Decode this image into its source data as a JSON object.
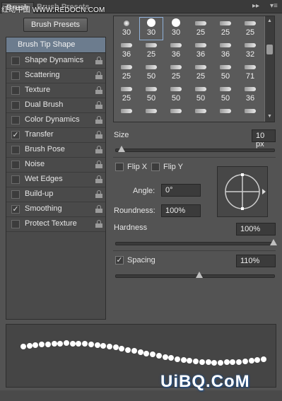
{
  "tabs": {
    "brush": "Brush",
    "brush_presets": "Brush Presets"
  },
  "watermark": "红动中国 WWW.REDOCN.COM",
  "presets_button": "Brush Presets",
  "tip_shape": "Brush Tip Shape",
  "options": [
    {
      "label": "Shape Dynamics",
      "checked": false
    },
    {
      "label": "Scattering",
      "checked": false
    },
    {
      "label": "Texture",
      "checked": false
    },
    {
      "label": "Dual Brush",
      "checked": false
    },
    {
      "label": "Color Dynamics",
      "checked": false
    },
    {
      "label": "Transfer",
      "checked": true
    },
    {
      "label": "Brush Pose",
      "checked": false
    },
    {
      "label": "Noise",
      "checked": false
    },
    {
      "label": "Wet Edges",
      "checked": false
    },
    {
      "label": "Build-up",
      "checked": false
    },
    {
      "label": "Smoothing",
      "checked": true
    },
    {
      "label": "Protect Texture",
      "checked": false
    }
  ],
  "brush_grid": [
    [
      "30",
      "30",
      "30",
      "25",
      "25",
      "25"
    ],
    [
      "36",
      "25",
      "36",
      "36",
      "36",
      "32"
    ],
    [
      "25",
      "50",
      "25",
      "25",
      "50",
      "71"
    ],
    [
      "25",
      "50",
      "50",
      "50",
      "50",
      "36"
    ],
    [
      "",
      "",
      "",
      "",
      "",
      ""
    ]
  ],
  "size": {
    "label": "Size",
    "value": "10 px"
  },
  "flip_x": {
    "label": "Flip X",
    "checked": false
  },
  "flip_y": {
    "label": "Flip Y",
    "checked": false
  },
  "angle": {
    "label": "Angle:",
    "value": "0°"
  },
  "roundness": {
    "label": "Roundness:",
    "value": "100%"
  },
  "hardness": {
    "label": "Hardness",
    "value": "100%"
  },
  "spacing": {
    "label": "Spacing",
    "value": "110%",
    "checked": true
  },
  "logo": "UiBQ.CoM",
  "colors": {
    "selected_tip": "#6c7c8e",
    "panel": "#535353"
  }
}
